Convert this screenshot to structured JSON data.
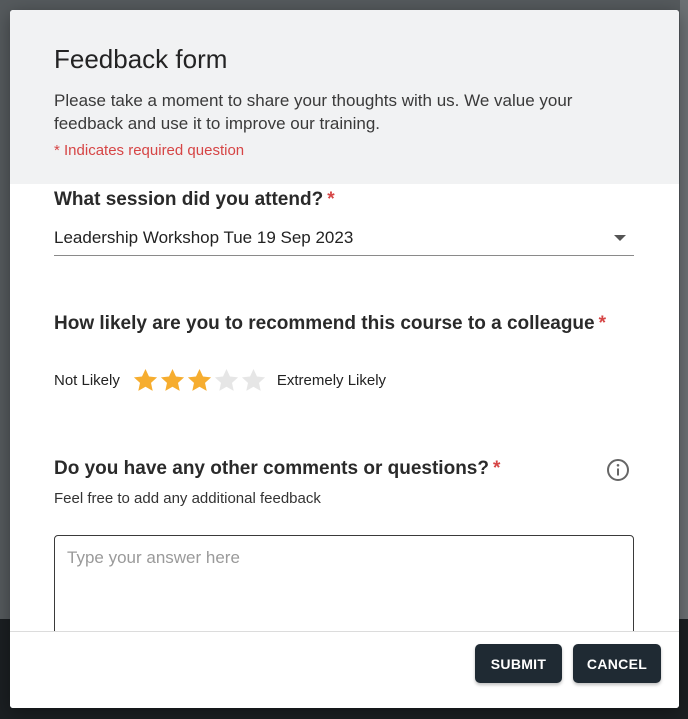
{
  "form": {
    "title": "Feedback form",
    "description": "Please take a moment to share your thoughts with us. We value your feedback and use it to improve our training.",
    "required_note": "* Indicates required question"
  },
  "questions": [
    {
      "label": "What session did you attend?",
      "required_marker": "*",
      "selected_value": "Leadership Workshop Tue 19 Sep 2023"
    },
    {
      "label": "How likely are you to recommend this course to a colleague",
      "required_marker": "*",
      "low_label": "Not Likely",
      "high_label": "Extremely Likely",
      "rating": 3,
      "rating_max": 5
    },
    {
      "label": "Do you have any other comments or questions?",
      "required_marker": "*",
      "hint": "Feel free to add any additional feedback",
      "placeholder": "Type your answer here",
      "value": ""
    }
  ],
  "buttons": {
    "submit_label": "SUBMIT",
    "cancel_label": "CANCEL"
  },
  "colors": {
    "required": "#d64545",
    "star_filled": "#f6ad2f",
    "star_empty": "#e6e6e6",
    "button_bg": "#1f2a33"
  },
  "icons": {
    "select_caret": "chevron-down-icon",
    "star": "star-icon",
    "info": "info-icon"
  }
}
